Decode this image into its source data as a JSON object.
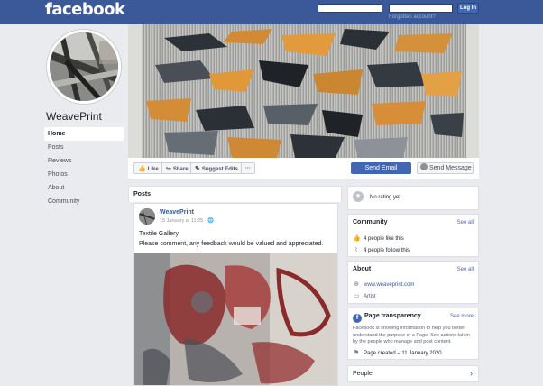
{
  "topbar": {
    "logo": "facebook",
    "email_value": "",
    "password_value": "",
    "login_label": "Log In",
    "forgot_label": "Forgotten account?"
  },
  "page": {
    "name": "WeavePrint",
    "nav": [
      "Home",
      "Posts",
      "Reviews",
      "Photos",
      "About",
      "Community"
    ],
    "active_nav": "Home"
  },
  "actions": {
    "like": "Like",
    "share": "Share",
    "suggest": "Suggest Edits",
    "more": "···",
    "send_email": "Send Email",
    "send_message": "Send Message"
  },
  "posts": {
    "header": "Posts",
    "items": [
      {
        "author": "WeavePrint",
        "time": "15 January at 11:25 · ",
        "line1": "Textile Gallery.",
        "line2": "Please comment, any feedback would be valued and appreciated."
      }
    ]
  },
  "rating": {
    "text": "No rating yet"
  },
  "community": {
    "title": "Community",
    "see_all": "See all",
    "likes": "4 people like this",
    "follows": "4 people follow this"
  },
  "about": {
    "title": "About",
    "see_all": "See all",
    "website": "www.weaveprint.com",
    "category": "Artist"
  },
  "transparency": {
    "title": "Page transparency",
    "see_more": "See more",
    "description": "Facebook is showing information to help you better understand the purpose of a Page. See actions taken by the people who manage and post content.",
    "created": "Page created – 11 January 2020"
  },
  "people": {
    "title": "People"
  },
  "colors": {
    "brand": "#3b5998",
    "accent": "#4267b2",
    "link": "#365899",
    "background": "#e9ebee"
  }
}
